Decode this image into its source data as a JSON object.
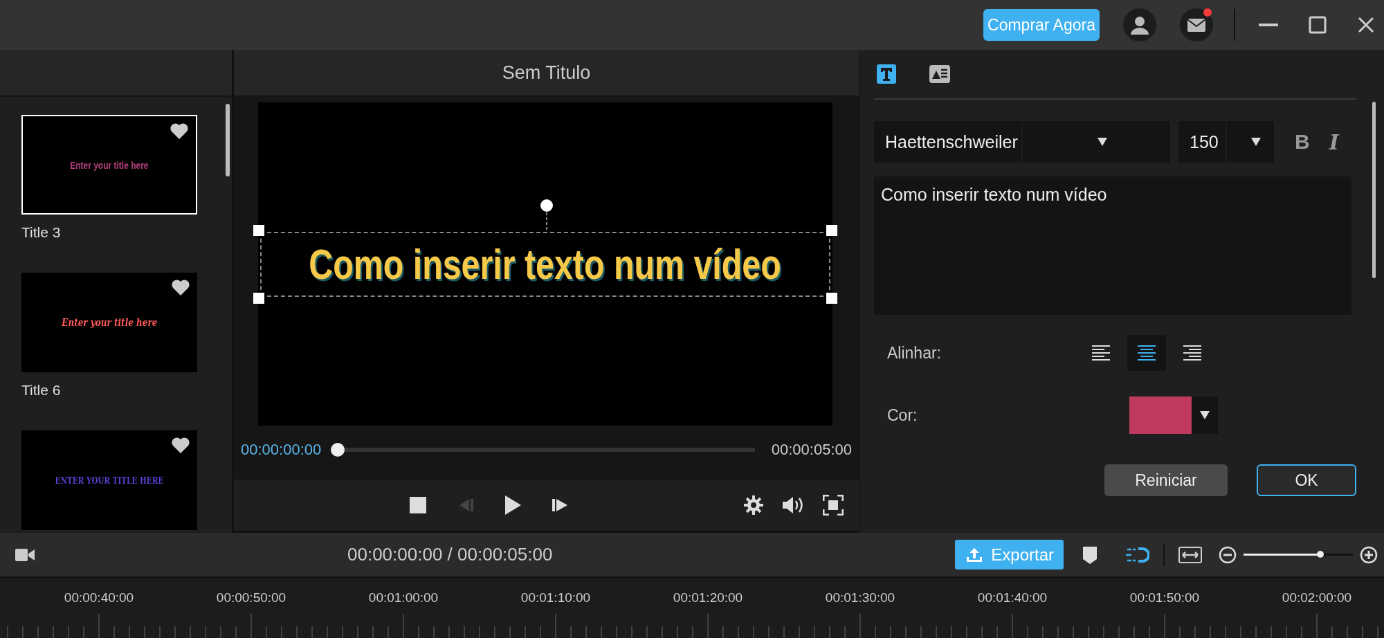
{
  "top_bar": {
    "buy_button": "Comprar Agora",
    "mail_unread": true
  },
  "templates": [
    {
      "label": "Title 3",
      "preview_text": "Enter your title here",
      "color": "#b2407c",
      "selected": true
    },
    {
      "label": "Title 6",
      "preview_text": "Enter your title here",
      "color": "#ff5a5a",
      "selected": false
    },
    {
      "preview_text": "ENTER YOUR TITLE HERE",
      "color": "#5a3fd0",
      "selected": false
    }
  ],
  "preview": {
    "title": "Sem Titulo",
    "caption": "Como inserir texto num vídeo",
    "current_time": "00:00:00:00",
    "duration": "00:00:05:00",
    "level": 0,
    "controls": [
      {
        "kind": "stop",
        "disabled": false
      },
      {
        "kind": "prev",
        "disabled": true
      },
      {
        "kind": "play",
        "disabled": false
      },
      {
        "kind": "next",
        "disabled": false
      }
    ]
  },
  "editor": {
    "tabs": [
      {
        "kind": "text",
        "selected": true
      },
      {
        "kind": "image",
        "selected": false
      }
    ],
    "font": "Haettenschweiler",
    "size": "150",
    "style_toggles": [
      {
        "kind": "bold",
        "label": "B",
        "on": false
      },
      {
        "kind": "italic",
        "label": "I",
        "on": false
      }
    ],
    "text": "Como inserir texto num vídeo",
    "align_label": "Alinhar:",
    "align": [
      {
        "kind": "left",
        "selected": false
      },
      {
        "kind": "center",
        "selected": true
      },
      {
        "kind": "right",
        "selected": false
      }
    ],
    "color_label": "Cor:",
    "color": "#c0395f",
    "buttons": [
      {
        "label": "Reiniciar",
        "kind": "secondary"
      },
      {
        "label": "OK",
        "kind": "primary"
      }
    ]
  },
  "timeline": {
    "position": "00:00:00:00 / 00:00:05:00",
    "export_button": "Exportar",
    "zoom": {
      "level": 0.7
    },
    "ruler": [
      "00:00:40:00",
      "00:00:50:00",
      "00:01:00:00",
      "00:01:10:00",
      "00:01:20:00",
      "00:01:30:00",
      "00:01:40:00",
      "00:01:50:00",
      "00:02:00:00"
    ]
  }
}
